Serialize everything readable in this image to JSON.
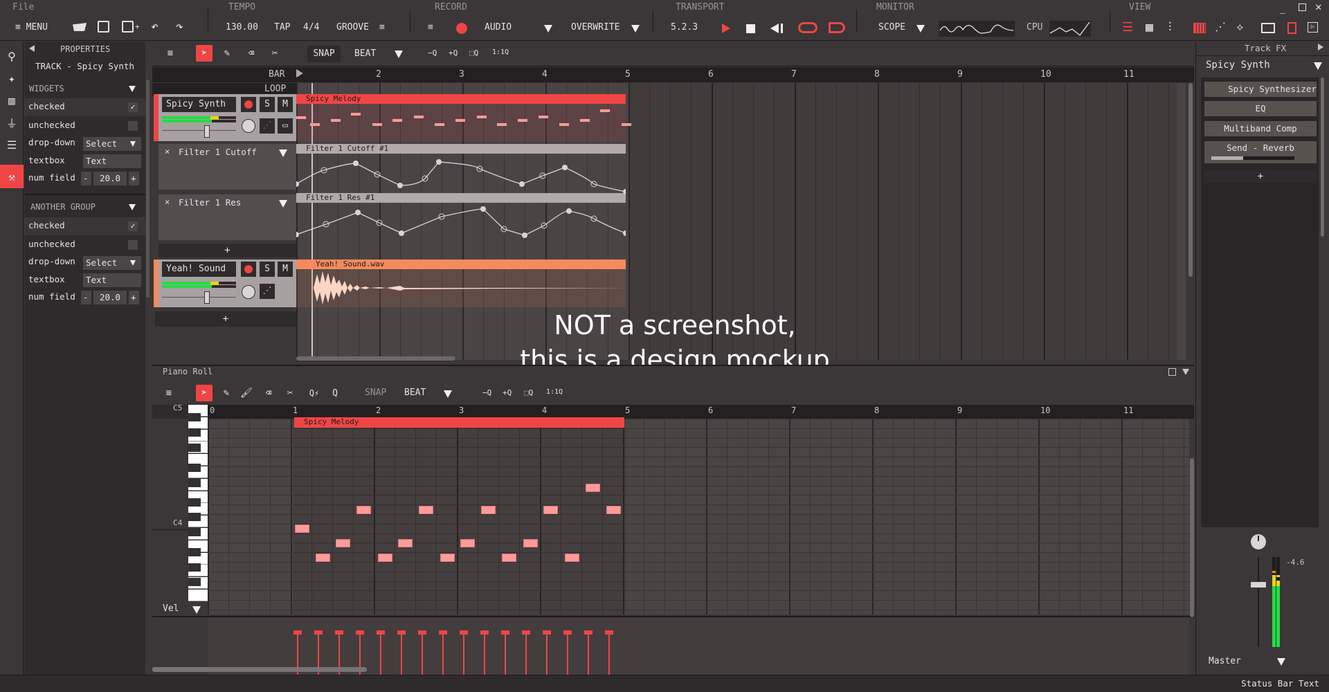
{
  "topbar": {
    "file_label": "File",
    "menu_label": "MENU",
    "sections": {
      "tempo": "TEMPO",
      "record": "RECORD",
      "transport": "TRANSPORT",
      "monitor": "MONITOR",
      "view": "VIEW"
    },
    "tempo_value": "130.00",
    "tap_label": "TAP",
    "time_signature": "4/4",
    "groove_label": "GROOVE",
    "record_mode": "AUDIO",
    "overwrite_mode": "OVERWRITE",
    "position": "5.2.3",
    "monitor_mode": "SCOPE",
    "cpu_label": "CPU"
  },
  "properties": {
    "header": "PROPERTIES",
    "track_title": "TRACK - Spicy Synth",
    "groups": [
      {
        "title": "WIDGETS",
        "checked_label": "checked",
        "unchecked_label": "unchecked",
        "dropdown_label": "drop-down",
        "dropdown_value": "Select",
        "textbox_label": "textbox",
        "textbox_value": "Text",
        "num_label": "num field",
        "num_value": "20.0"
      },
      {
        "title": "ANOTHER GROUP",
        "checked_label": "checked",
        "unchecked_label": "unchecked",
        "dropdown_label": "drop-down",
        "dropdown_value": "Select",
        "textbox_label": "textbox",
        "textbox_value": "Text",
        "num_label": "num field",
        "num_value": "20.0"
      }
    ],
    "minus": "-",
    "plus": "+",
    "check_glyph": "✓"
  },
  "tracks": {
    "snap_label": "SNAP",
    "beat_label": "BEAT",
    "zoom_labels": [
      "−Q",
      "+Q",
      "⬚Q",
      "1:1Q"
    ],
    "bar_label": "BAR",
    "loop_label": "LOOP",
    "bar_numbers": [
      "2",
      "3",
      "4",
      "5",
      "6",
      "7",
      "8",
      "9",
      "10",
      "11"
    ],
    "track1": {
      "name": "Spicy Synth",
      "clip": "Spicy Melody",
      "color": "#f04545"
    },
    "lanes": [
      {
        "name": "Filter 1 Cutoff",
        "clip": "Filter 1 Cutoff #1"
      },
      {
        "name": "Filter 1 Res",
        "clip": "Filter 1 Res #1"
      }
    ],
    "track2": {
      "name": "Yeah! Sound",
      "clip": "Yeah! Sound.wav",
      "color": "#f58b5c"
    },
    "s_label": "S",
    "m_label": "M",
    "add_label": "+",
    "lane_close": "×"
  },
  "watermark": {
    "line1": "NOT a screenshot,",
    "line2": "this is a design mockup"
  },
  "pianoroll": {
    "title": "Piano Roll",
    "snap_label": "SNAP",
    "beat_label": "BEAT",
    "zoom_labels": [
      "−Q",
      "+Q",
      "⬚Q",
      "1:1Q"
    ],
    "bar_numbers": [
      "0",
      "1",
      "2",
      "3",
      "4",
      "5",
      "6",
      "7",
      "8",
      "9",
      "10",
      "11"
    ],
    "clip": "Spicy Melody",
    "c5_label": "C5",
    "c4_label": "C4",
    "vel_label": "Vel"
  },
  "fx": {
    "header": "Track FX",
    "track_select": "Spicy Synth",
    "slots": [
      "Spicy Synthesizer",
      "EQ",
      "Multiband Comp",
      "Send - Reverb"
    ],
    "send_amount": 0.38,
    "add_label": "+",
    "master_db": "-4.6",
    "master_label": "Master"
  },
  "statusbar": {
    "text": "Status Bar Text"
  },
  "colors": {
    "accent": "#f04545",
    "audio": "#f58b5c",
    "note": "#ff9a9a",
    "meter_green": "#22dd44",
    "meter_yellow": "#e8d21c"
  }
}
